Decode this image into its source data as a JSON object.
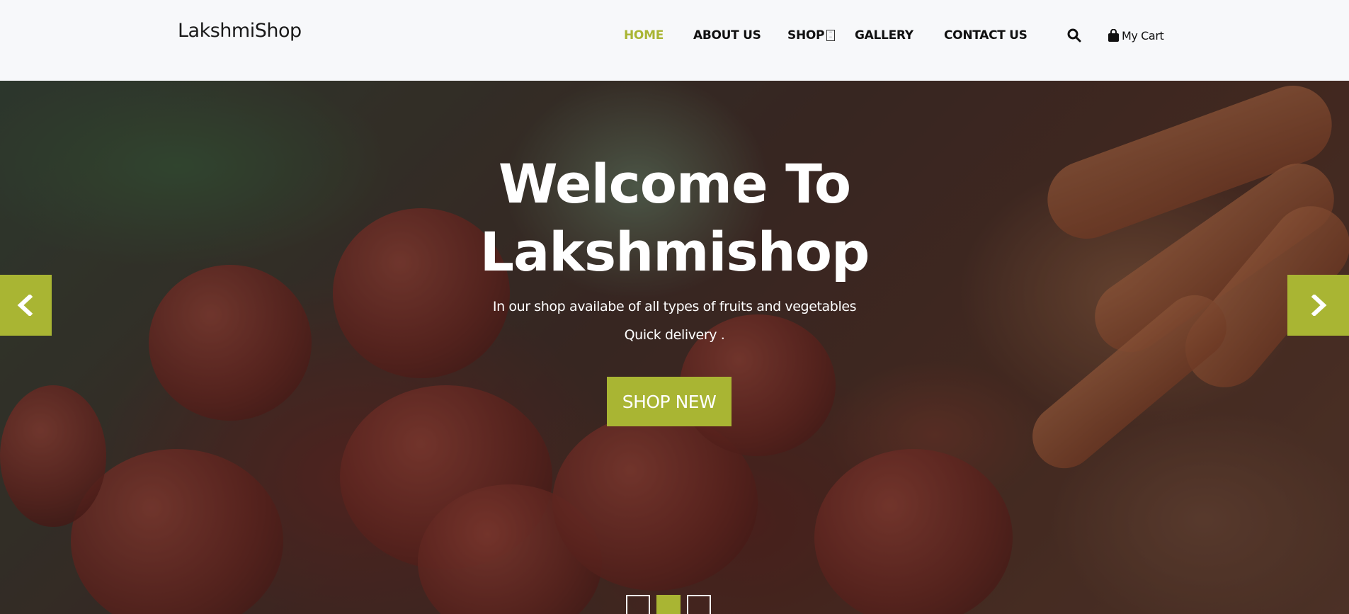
{
  "header": {
    "logo": "LakshmiShop",
    "nav": [
      {
        "label": "HOME",
        "active": true
      },
      {
        "label": "ABOUT US",
        "active": false
      },
      {
        "label": "SHOP",
        "active": false
      },
      {
        "label": "GALLERY",
        "active": false
      },
      {
        "label": "CONTACT US",
        "active": false
      }
    ],
    "search_icon": "search-icon",
    "cart_icon": "shopping-bag-icon",
    "cart_label": "My Cart"
  },
  "hero": {
    "title_line1": "Welcome To",
    "title_line2": "Lakshmishop",
    "subtitle_line1": "In our shop availabe of all types of fruits and vegetables",
    "subtitle_line2": "Quick delivery .",
    "cta_label": "SHOP NEW",
    "prev_icon": "chevron-left-icon",
    "next_icon": "chevron-right-icon",
    "slides": 3,
    "active_slide": 2
  },
  "colors": {
    "accent": "#a9b533",
    "header_bg": "#f7f8fa",
    "text_dark": "#111111",
    "text_light": "#ffffff"
  }
}
